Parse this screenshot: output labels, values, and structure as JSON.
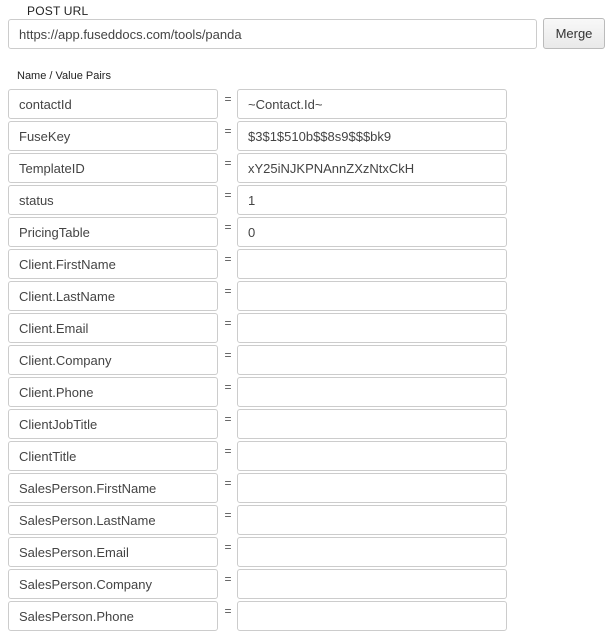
{
  "post_url": {
    "label": "POST URL",
    "value": "https://app.fuseddocs.com/tools/panda",
    "merge_label": "Merge"
  },
  "pairs_label": "Name / Value Pairs",
  "equals_sign": "=",
  "pairs": [
    {
      "name": "contactId",
      "value": "~Contact.Id~"
    },
    {
      "name": "FuseKey",
      "value": "$3$1$510b$$8s9$$$bk9"
    },
    {
      "name": "TemplateID",
      "value": "xY25iNJKPNAnnZXzNtxCkH"
    },
    {
      "name": "status",
      "value": "1"
    },
    {
      "name": "PricingTable",
      "value": "0"
    },
    {
      "name": "Client.FirstName",
      "value": ""
    },
    {
      "name": "Client.LastName",
      "value": ""
    },
    {
      "name": "Client.Email",
      "value": ""
    },
    {
      "name": "Client.Company",
      "value": ""
    },
    {
      "name": "Client.Phone",
      "value": ""
    },
    {
      "name": "ClientJobTitle",
      "value": ""
    },
    {
      "name": "ClientTitle",
      "value": ""
    },
    {
      "name": "SalesPerson.FirstName",
      "value": ""
    },
    {
      "name": "SalesPerson.LastName",
      "value": ""
    },
    {
      "name": "SalesPerson.Email",
      "value": ""
    },
    {
      "name": "SalesPerson.Company",
      "value": ""
    },
    {
      "name": "SalesPerson.Phone",
      "value": ""
    }
  ]
}
